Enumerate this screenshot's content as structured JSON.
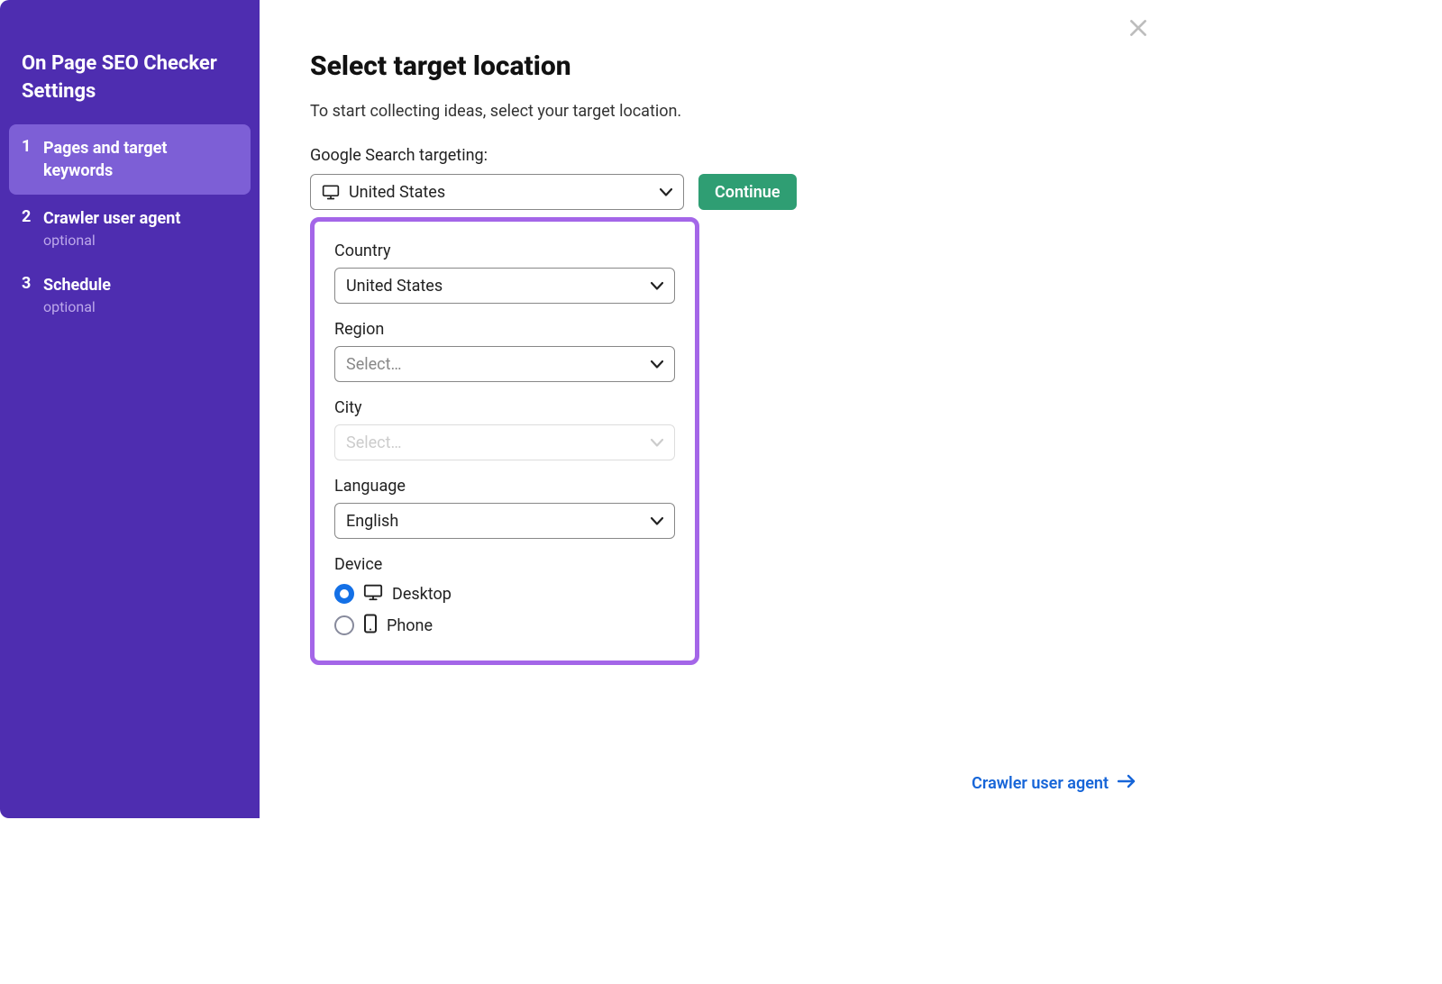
{
  "sidebar": {
    "title": "On Page SEO Checker Settings",
    "steps": [
      {
        "num": "1",
        "label": "Pages and target keywords",
        "sub": "",
        "active": true
      },
      {
        "num": "2",
        "label": "Crawler user agent",
        "sub": "optional",
        "active": false
      },
      {
        "num": "3",
        "label": "Schedule",
        "sub": "optional",
        "active": false
      }
    ]
  },
  "main": {
    "title": "Select target location",
    "subtitle": "To start collecting ideas, select your target location.",
    "targeting_label": "Google Search targeting:",
    "targeting_value": "United States",
    "continue_label": "Continue",
    "panel": {
      "country_label": "Country",
      "country_value": "United States",
      "region_label": "Region",
      "region_placeholder": "Select…",
      "city_label": "City",
      "city_placeholder": "Select…",
      "language_label": "Language",
      "language_value": "English",
      "device_label": "Device",
      "device_options": {
        "desktop": "Desktop",
        "phone": "Phone"
      }
    },
    "footer_link": "Crawler user agent"
  }
}
